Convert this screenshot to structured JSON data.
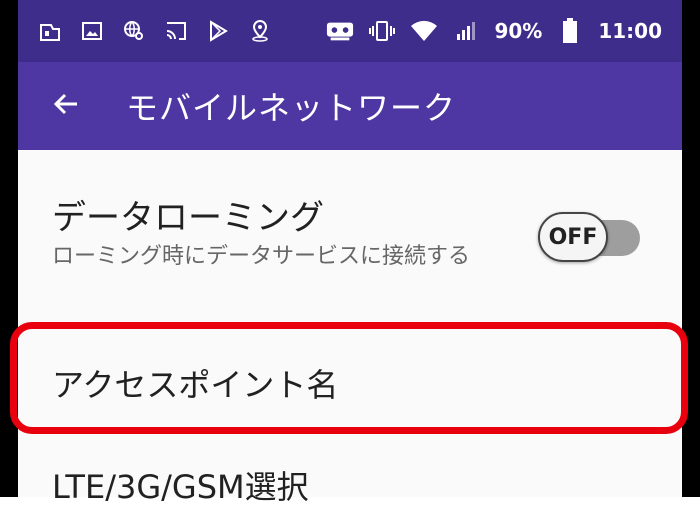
{
  "status_bar": {
    "icons_left": [
      "sim-icon",
      "image-icon",
      "globe-search-icon",
      "cast-icon",
      "play-store-icon",
      "location-icon"
    ],
    "icons_right": [
      "vr-icon",
      "vibrate-icon",
      "wifi-icon",
      "signal-icon",
      "battery-icon"
    ],
    "battery_percent": "90%",
    "time": "11:00"
  },
  "app_bar": {
    "back_icon": "arrow-back-icon",
    "title": "モバイルネットワーク",
    "background": "#4e37a2",
    "status_background": "#3f2d8c"
  },
  "settings": {
    "data_roaming": {
      "title": "データローミング",
      "summary": "ローミング時にデータサービスに接続する",
      "toggle_label": "OFF",
      "enabled": false
    },
    "apn": {
      "label": "アクセスポイント名",
      "highlight_color": "#e8000e"
    },
    "network_mode": {
      "label": "LTE/3G/GSM選択"
    }
  }
}
